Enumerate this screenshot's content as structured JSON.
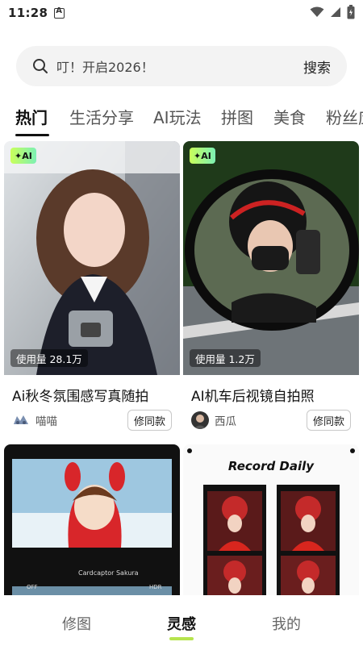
{
  "status": {
    "time": "11:28"
  },
  "search": {
    "placeholder": "叮！开启2026！",
    "button_label": "搜索"
  },
  "tabs": [
    "热门",
    "生活分享",
    "AI玩法",
    "拼图",
    "美食",
    "粉丝应"
  ],
  "cards": [
    {
      "badge": "✦AI",
      "usage": "使用量 28.1万",
      "title": "Ai秋冬氛围感写真随拍",
      "author": "喵喵",
      "action": "修同款"
    },
    {
      "badge": "✦AI",
      "usage": "使用量 1.2万",
      "title": "AI机车后视镜自拍照",
      "author": "西瓜",
      "action": "修同款"
    },
    {
      "film_caption": "Cardcaptor Sakura",
      "left_marker": "OFF",
      "right_marker": "HDR"
    },
    {
      "heading": "Record Daily"
    }
  ],
  "bottom_nav": [
    "修图",
    "灵感",
    "我的"
  ],
  "colors": {
    "accent": "#b6e44e",
    "ai_badge_start": "#c9ff5a",
    "ai_badge_end": "#7cf0b4"
  }
}
